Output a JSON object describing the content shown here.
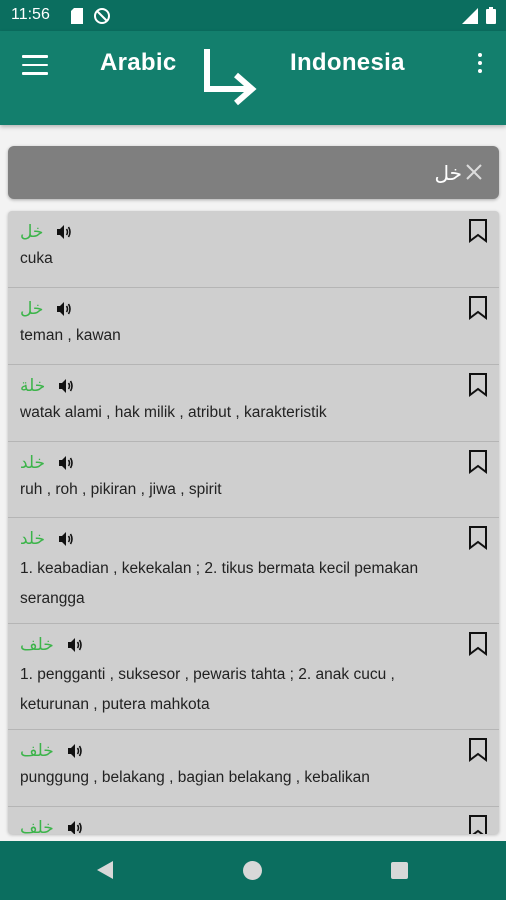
{
  "status_bar": {
    "time": "11:56",
    "icons": [
      "sd-card-icon",
      "no-sync-icon",
      "signal-icon",
      "battery-icon"
    ]
  },
  "app_bar": {
    "source_language": "Arabic",
    "target_language": "Indonesia",
    "swap_icon": "arrow-down-right-icon",
    "menu_icon": "hamburger-menu-icon",
    "more_icon": "more-vert-icon"
  },
  "search": {
    "value": "خل",
    "clear_icon": "close-icon"
  },
  "results": [
    {
      "word": "خل",
      "definition": "cuka"
    },
    {
      "word": "خل",
      "definition": "teman , kawan"
    },
    {
      "word": "خلة",
      "definition": "watak alami , hak milik , atribut , karakteristik"
    },
    {
      "word": "خلد",
      "definition": "ruh , roh , pikiran , jiwa , spirit"
    },
    {
      "word": "خلد",
      "definition": "1. keabadian , kekekalan ; 2. tikus bermata kecil pemakan serangga"
    },
    {
      "word": "خلف",
      "definition": "1. pengganti , suksesor , pewaris tahta ; 2. anak cucu , keturunan , putera mahkota"
    },
    {
      "word": "خلف",
      "definition": "punggung , belakang , bagian belakang , kebalikan"
    },
    {
      "word": "خلف",
      "definition": ""
    }
  ],
  "colors": {
    "status_bar": "#0b6e5f",
    "app_bar": "#137f6d",
    "arabic_word": "#3cb44a",
    "search_box": "#7f7f7f",
    "list_background": "#cfcfcf"
  },
  "nav_bar": {
    "icons": [
      "back-icon",
      "home-icon",
      "recents-icon"
    ]
  }
}
